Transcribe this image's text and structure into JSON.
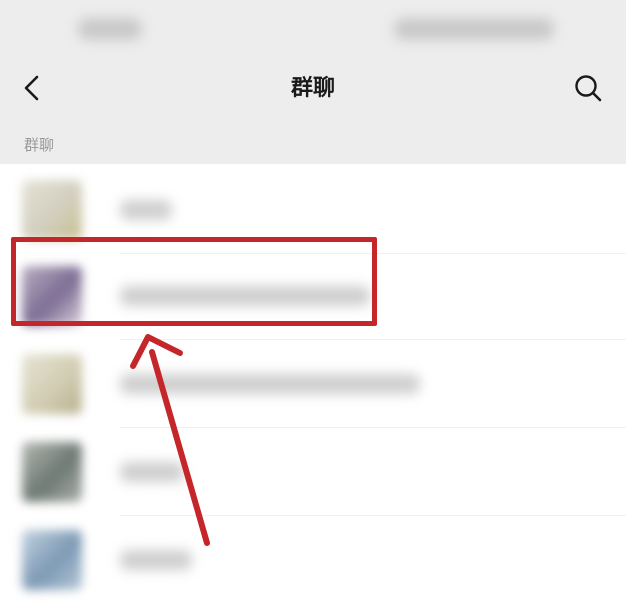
{
  "nav": {
    "title": "群聊"
  },
  "section": {
    "label": "群聊"
  },
  "groups": [
    {
      "avatar_color": "#d8d6c8",
      "avatar_accent": "#c9bf8f"
    },
    {
      "avatar_color": "#9c8aa8",
      "avatar_accent": "#6a5a80"
    },
    {
      "avatar_color": "#dcd8c4",
      "avatar_accent": "#b8b08c"
    },
    {
      "avatar_color": "#8f968f",
      "avatar_accent": "#5f6a66"
    },
    {
      "avatar_color": "#9db6cc",
      "avatar_accent": "#6a8aa8"
    }
  ],
  "colors": {
    "header_bg": "#ededed",
    "annotation_red": "#c4262a",
    "text_primary": "#1a1a1a",
    "text_secondary": "#9a9a9a"
  },
  "icons": {
    "back": "chevron-left-icon",
    "search": "search-icon",
    "annotation": "arrow-annotation-icon"
  }
}
